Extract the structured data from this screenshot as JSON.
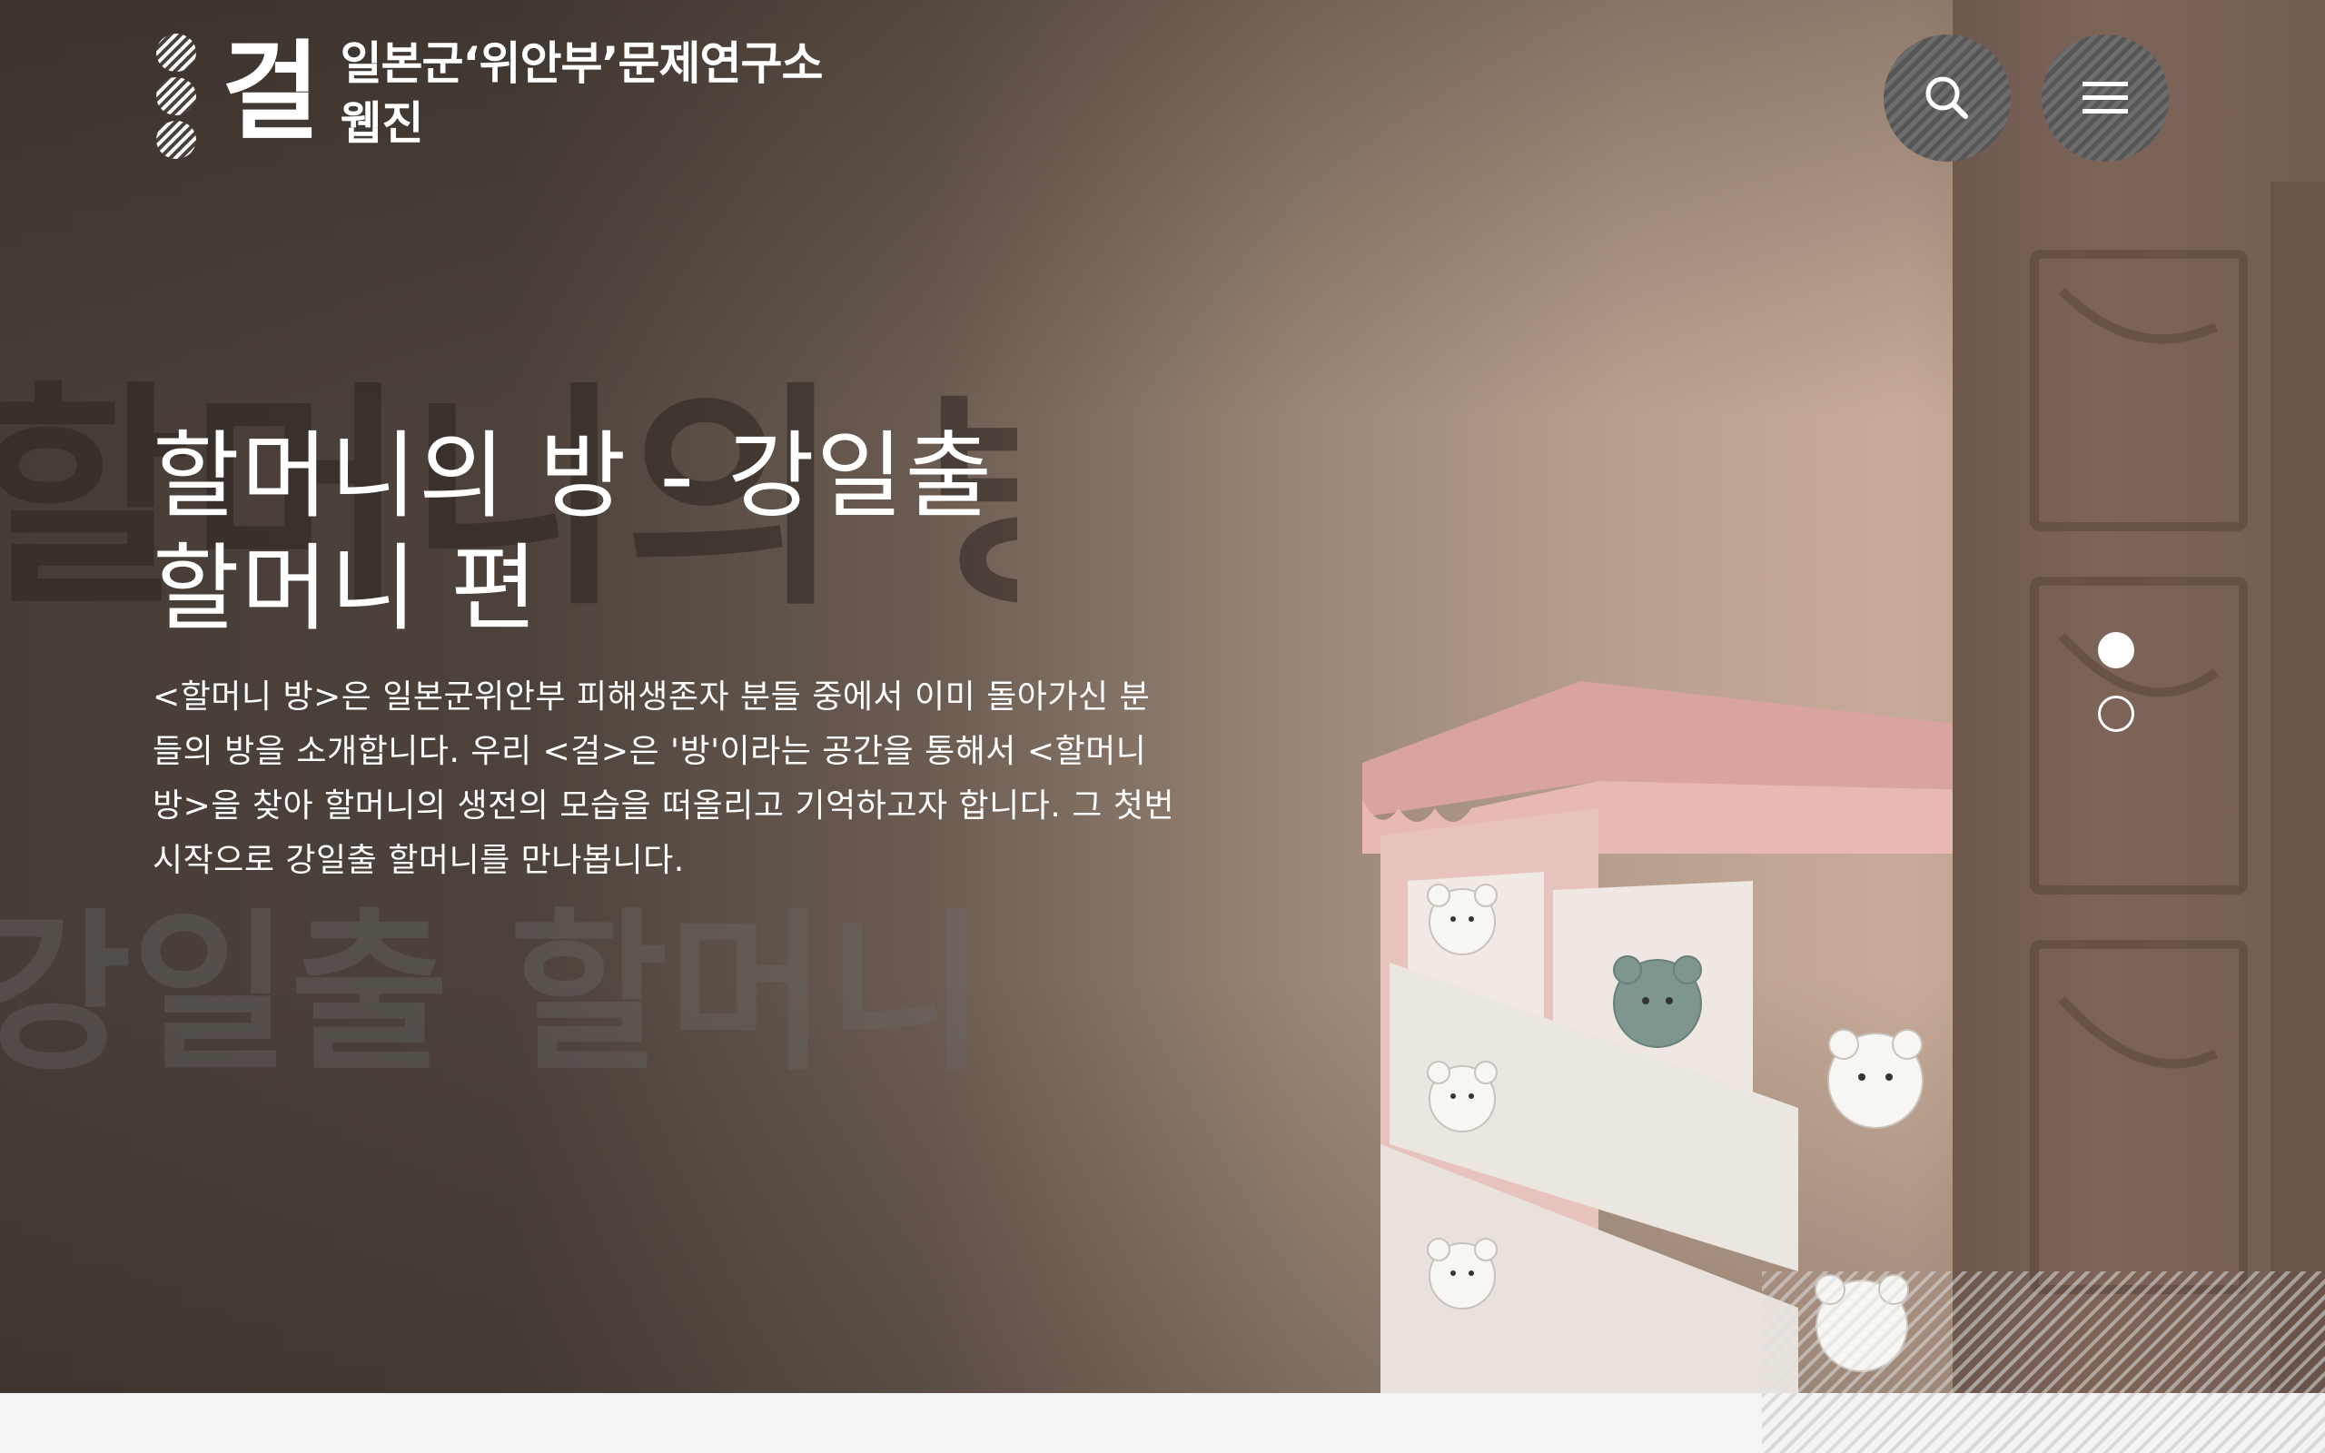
{
  "header": {
    "logo_char": "걸",
    "logo_line1": "일본군‘위안부’문제연구소",
    "logo_line2": "웹진",
    "search_icon": "search-icon",
    "menu_icon": "hamburger-menu-icon"
  },
  "hero": {
    "title_line1": "할머니의 방 - 강일출",
    "title_line2": "할머니 편",
    "description": "<할머니 방>은 일본군위안부 피해생존자 분들 중에서 이미 돌아가신 분들의 방을 소개합니다. 우리 <걸>은 '방'이라는 공간을 통해서 <할머니 방>을 찾아 할머니의 생전의 모습을 떠올리고 기억하고자 합니다. 그 첫번 시작으로 강일출 할머니를 만나봅니다.",
    "background_text_1": "할머니의 방",
    "background_text_2": "강일출 할머니 편 -",
    "slides": {
      "count": 2,
      "active": 1
    }
  },
  "colors": {
    "accent_white": "#ffffff",
    "bg_dark": "#473d37",
    "bg_light": "#c6ab98",
    "dresser_pink": "#e3b4b0"
  }
}
